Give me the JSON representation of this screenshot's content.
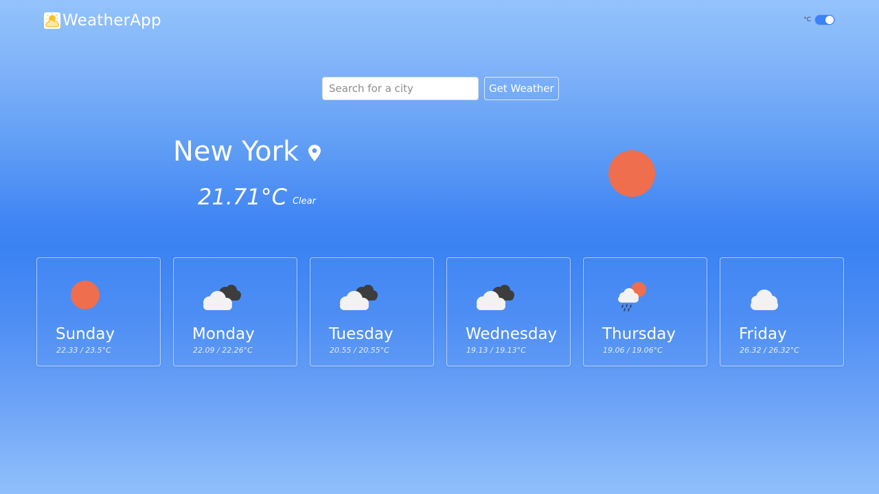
{
  "app": {
    "title": "WeatherApp",
    "logo_icon": "sun-behind-cloud-icon"
  },
  "unit_toggle": {
    "label": "°C",
    "enabled": true
  },
  "search": {
    "placeholder": "Search for a city",
    "value": "",
    "button_label": "Get Weather"
  },
  "current": {
    "city": "New York",
    "temperature": "21.71°C",
    "condition": "Clear",
    "icon": "sun-icon",
    "location_icon": "map-pin-icon"
  },
  "forecast": [
    {
      "day": "Sunday",
      "range": "22.33 / 23.5°C",
      "icon": "sun-icon"
    },
    {
      "day": "Monday",
      "range": "22.09 / 22.26°C",
      "icon": "broken-clouds-icon"
    },
    {
      "day": "Tuesday",
      "range": "20.55 / 20.55°C",
      "icon": "broken-clouds-icon"
    },
    {
      "day": "Wednesday",
      "range": "19.13 / 19.13°C",
      "icon": "broken-clouds-icon"
    },
    {
      "day": "Thursday",
      "range": "19.06 / 19.06°C",
      "icon": "rain-sun-icon"
    },
    {
      "day": "Friday",
      "range": "26.32 / 26.32°C",
      "icon": "cloud-icon"
    }
  ],
  "colors": {
    "accent": "#3b82f6",
    "sun": "#ee6e4d",
    "cloud": "#f2f2f2",
    "dark_cloud": "#3d3d3d"
  }
}
